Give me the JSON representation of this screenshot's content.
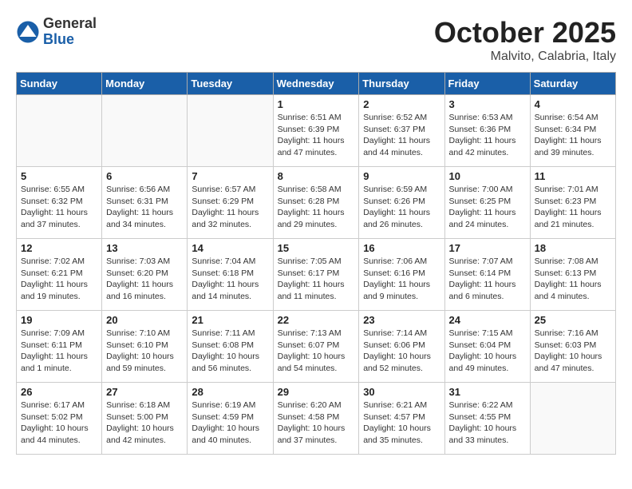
{
  "header": {
    "logo_general": "General",
    "logo_blue": "Blue",
    "month": "October 2025",
    "location": "Malvito, Calabria, Italy"
  },
  "days_of_week": [
    "Sunday",
    "Monday",
    "Tuesday",
    "Wednesday",
    "Thursday",
    "Friday",
    "Saturday"
  ],
  "weeks": [
    [
      {
        "day": "",
        "info": ""
      },
      {
        "day": "",
        "info": ""
      },
      {
        "day": "",
        "info": ""
      },
      {
        "day": "1",
        "info": "Sunrise: 6:51 AM\nSunset: 6:39 PM\nDaylight: 11 hours and 47 minutes."
      },
      {
        "day": "2",
        "info": "Sunrise: 6:52 AM\nSunset: 6:37 PM\nDaylight: 11 hours and 44 minutes."
      },
      {
        "day": "3",
        "info": "Sunrise: 6:53 AM\nSunset: 6:36 PM\nDaylight: 11 hours and 42 minutes."
      },
      {
        "day": "4",
        "info": "Sunrise: 6:54 AM\nSunset: 6:34 PM\nDaylight: 11 hours and 39 minutes."
      }
    ],
    [
      {
        "day": "5",
        "info": "Sunrise: 6:55 AM\nSunset: 6:32 PM\nDaylight: 11 hours and 37 minutes."
      },
      {
        "day": "6",
        "info": "Sunrise: 6:56 AM\nSunset: 6:31 PM\nDaylight: 11 hours and 34 minutes."
      },
      {
        "day": "7",
        "info": "Sunrise: 6:57 AM\nSunset: 6:29 PM\nDaylight: 11 hours and 32 minutes."
      },
      {
        "day": "8",
        "info": "Sunrise: 6:58 AM\nSunset: 6:28 PM\nDaylight: 11 hours and 29 minutes."
      },
      {
        "day": "9",
        "info": "Sunrise: 6:59 AM\nSunset: 6:26 PM\nDaylight: 11 hours and 26 minutes."
      },
      {
        "day": "10",
        "info": "Sunrise: 7:00 AM\nSunset: 6:25 PM\nDaylight: 11 hours and 24 minutes."
      },
      {
        "day": "11",
        "info": "Sunrise: 7:01 AM\nSunset: 6:23 PM\nDaylight: 11 hours and 21 minutes."
      }
    ],
    [
      {
        "day": "12",
        "info": "Sunrise: 7:02 AM\nSunset: 6:21 PM\nDaylight: 11 hours and 19 minutes."
      },
      {
        "day": "13",
        "info": "Sunrise: 7:03 AM\nSunset: 6:20 PM\nDaylight: 11 hours and 16 minutes."
      },
      {
        "day": "14",
        "info": "Sunrise: 7:04 AM\nSunset: 6:18 PM\nDaylight: 11 hours and 14 minutes."
      },
      {
        "day": "15",
        "info": "Sunrise: 7:05 AM\nSunset: 6:17 PM\nDaylight: 11 hours and 11 minutes."
      },
      {
        "day": "16",
        "info": "Sunrise: 7:06 AM\nSunset: 6:16 PM\nDaylight: 11 hours and 9 minutes."
      },
      {
        "day": "17",
        "info": "Sunrise: 7:07 AM\nSunset: 6:14 PM\nDaylight: 11 hours and 6 minutes."
      },
      {
        "day": "18",
        "info": "Sunrise: 7:08 AM\nSunset: 6:13 PM\nDaylight: 11 hours and 4 minutes."
      }
    ],
    [
      {
        "day": "19",
        "info": "Sunrise: 7:09 AM\nSunset: 6:11 PM\nDaylight: 11 hours and 1 minute."
      },
      {
        "day": "20",
        "info": "Sunrise: 7:10 AM\nSunset: 6:10 PM\nDaylight: 10 hours and 59 minutes."
      },
      {
        "day": "21",
        "info": "Sunrise: 7:11 AM\nSunset: 6:08 PM\nDaylight: 10 hours and 56 minutes."
      },
      {
        "day": "22",
        "info": "Sunrise: 7:13 AM\nSunset: 6:07 PM\nDaylight: 10 hours and 54 minutes."
      },
      {
        "day": "23",
        "info": "Sunrise: 7:14 AM\nSunset: 6:06 PM\nDaylight: 10 hours and 52 minutes."
      },
      {
        "day": "24",
        "info": "Sunrise: 7:15 AM\nSunset: 6:04 PM\nDaylight: 10 hours and 49 minutes."
      },
      {
        "day": "25",
        "info": "Sunrise: 7:16 AM\nSunset: 6:03 PM\nDaylight: 10 hours and 47 minutes."
      }
    ],
    [
      {
        "day": "26",
        "info": "Sunrise: 6:17 AM\nSunset: 5:02 PM\nDaylight: 10 hours and 44 minutes."
      },
      {
        "day": "27",
        "info": "Sunrise: 6:18 AM\nSunset: 5:00 PM\nDaylight: 10 hours and 42 minutes."
      },
      {
        "day": "28",
        "info": "Sunrise: 6:19 AM\nSunset: 4:59 PM\nDaylight: 10 hours and 40 minutes."
      },
      {
        "day": "29",
        "info": "Sunrise: 6:20 AM\nSunset: 4:58 PM\nDaylight: 10 hours and 37 minutes."
      },
      {
        "day": "30",
        "info": "Sunrise: 6:21 AM\nSunset: 4:57 PM\nDaylight: 10 hours and 35 minutes."
      },
      {
        "day": "31",
        "info": "Sunrise: 6:22 AM\nSunset: 4:55 PM\nDaylight: 10 hours and 33 minutes."
      },
      {
        "day": "",
        "info": ""
      }
    ]
  ]
}
